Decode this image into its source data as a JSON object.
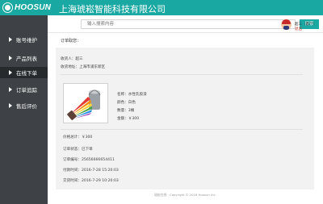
{
  "header": {
    "logo_text": "HOOSUN",
    "company_name": "上海琥崧智能科技有限公司",
    "accent_color": "#19a8a2"
  },
  "sidebar": {
    "items": [
      {
        "label": "账号维护",
        "active": false
      },
      {
        "label": "产品列表",
        "active": false
      },
      {
        "label": "在线下单",
        "active": true
      },
      {
        "label": "订单追踪",
        "active": false
      },
      {
        "label": "售后评价",
        "active": false
      }
    ]
  },
  "search": {
    "placeholder": "输入搜索内容",
    "button_label": "搜索"
  },
  "user": {
    "name": "超三（客户）",
    "logout": "退出"
  },
  "order": {
    "order_no_label": "订单取您：",
    "recipient": "收货人：超三",
    "address": "收货地址：上海市浦东新区",
    "product": {
      "name": "名称：水性乳胶漆",
      "color": "颜色：白色",
      "quantity": "数量：3桶",
      "amount": "金额：￥300"
    },
    "total": "价格总计：￥300",
    "status": "订单状态：已下单",
    "number": "订单编号：25656666654411",
    "pay_time": "付款时间：2016-7-28 15:20:03",
    "deal_time": "交货时间：2016-7-29 10:20:03"
  },
  "footer": {
    "copyright": "琥崧在线 · Copyright © 2016 Hoosun Inc."
  }
}
